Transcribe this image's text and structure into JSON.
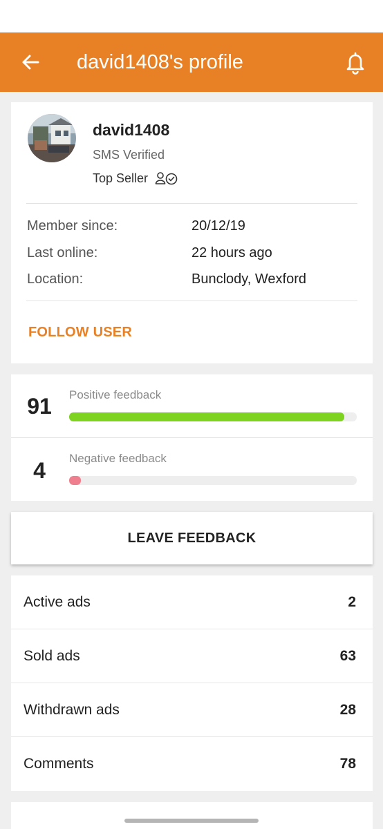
{
  "header": {
    "title": "david1408's profile",
    "back_icon": "arrow-left-icon",
    "notifications_icon": "bell-icon",
    "color": "#e88125"
  },
  "profile": {
    "username": "david1408",
    "verification": "SMS Verified",
    "badge": "Top Seller",
    "member_since_label": "Member since:",
    "member_since_value": "20/12/19",
    "last_online_label": "Last online:",
    "last_online_value": "22 hours ago",
    "location_label": "Location:",
    "location_value": "Bunclody, Wexford",
    "follow_label": "FOLLOW USER"
  },
  "feedback": {
    "positive": {
      "count": "91",
      "label": "Positive feedback",
      "fill_fraction": 0.957,
      "color": "#7ed321"
    },
    "negative": {
      "count": "4",
      "label": "Negative feedback",
      "fill_fraction": 0.042,
      "color": "#ef7f8e"
    }
  },
  "leave_feedback_label": "LEAVE FEEDBACK",
  "stats": [
    {
      "label": "Active ads",
      "value": "2"
    },
    {
      "label": "Sold ads",
      "value": "63"
    },
    {
      "label": "Withdrawn ads",
      "value": "28"
    },
    {
      "label": "Comments",
      "value": "78"
    }
  ]
}
